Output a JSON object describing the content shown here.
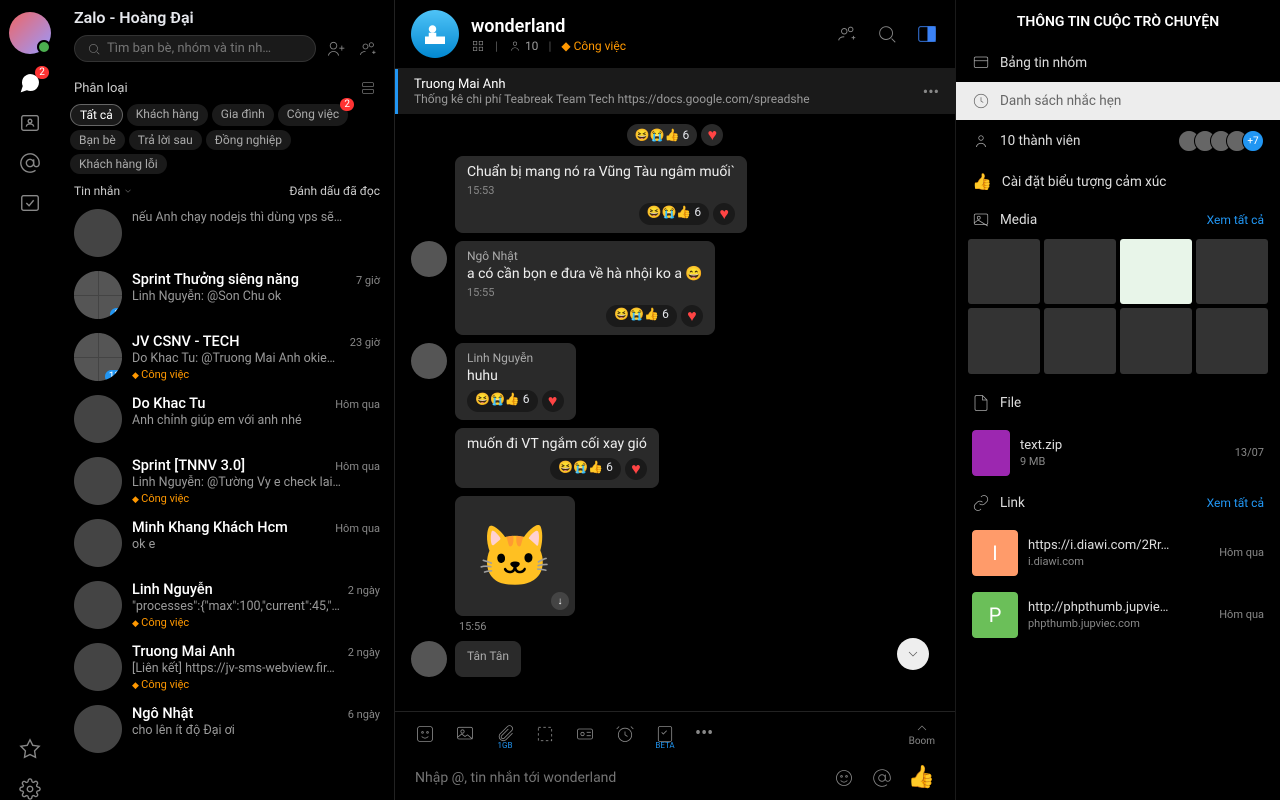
{
  "app_title": "Zalo - Hoàng Đại",
  "search_placeholder": "Tìm bạn bè, nhóm và tin nh…",
  "nav": {
    "chat_badge": "2"
  },
  "filter": {
    "label": "Phân loại",
    "chips": [
      "Tất cả",
      "Khách hàng",
      "Gia đình",
      "Công việc",
      "Bạn bè",
      "Trả lời sau",
      "Đồng nghiệp",
      "Khách hàng lỗi"
    ],
    "chip3_badge": "2"
  },
  "subheader": {
    "left": "Tin nhắn",
    "right": "Đánh dấu đã đọc"
  },
  "conversations": [
    {
      "name": "",
      "preview": "nếu Anh chạy nodejs thì dùng vps sẽ…",
      "time": "",
      "tag": "",
      "grp": false
    },
    {
      "name": "Sprint Thưởng siêng năng",
      "preview": "Linh Nguyễn: @Son Chu ok",
      "time": "7 giờ",
      "tag": "",
      "grp": true,
      "count": "9"
    },
    {
      "name": "JV CSNV - TECH",
      "preview": "Do Khac Tu: @Truong Mai Anh okie…",
      "time": "23 giờ",
      "tag": "Công việc",
      "grp": true,
      "count": "13"
    },
    {
      "name": "Do Khac Tu",
      "preview": "Anh chỉnh giúp em với anh nhé",
      "time": "Hôm qua",
      "tag": "",
      "grp": false
    },
    {
      "name": "Sprint [TNNV 3.0]",
      "preview": "Linh Nguyễn: @Tường Vy e check lai…",
      "time": "Hôm qua",
      "tag": "Công việc",
      "grp": false
    },
    {
      "name": "Minh Khang Khách Hcm",
      "preview": "ok e",
      "time": "Hôm qua",
      "tag": "",
      "grp": false
    },
    {
      "name": "Linh Nguyễn",
      "preview": "\"processes\":{\"max\":100,\"current\":45,\"…",
      "time": "2 ngày",
      "tag": "Công việc",
      "grp": false
    },
    {
      "name": "Truong Mai Anh",
      "preview": "[Liên kết] https://jv-sms-webview.fir…",
      "time": "2 ngày",
      "tag": "Công việc",
      "grp": false
    },
    {
      "name": "Ngô Nhật",
      "preview": "cho lên ít độ Đại ơi",
      "time": "6 ngày",
      "tag": "",
      "grp": false
    }
  ],
  "chat": {
    "title": "wonderland",
    "members": "10",
    "tag_label": "Công việc",
    "pinned": {
      "title": "Truong Mai Anh",
      "desc": "Thống kê chi phí Teabreak Team Tech https://docs.google.com/spreadshe"
    },
    "reac_top": "6",
    "messages": [
      {
        "sender": "",
        "text": "Chuẩn bị mang nó ra Vũng Tàu ngâm muối`",
        "time": "15:53",
        "reac": "6",
        "cont": true
      },
      {
        "sender": "Ngô Nhật",
        "text": "a có cần bọn e đưa về hà nhội ko a 😄",
        "time": "15:55",
        "reac": "6",
        "cont": false
      },
      {
        "sender": "Linh Nguyễn",
        "text": "huhu",
        "time": "",
        "reac": "6",
        "cont": false
      },
      {
        "sender": "",
        "text": "muốn đi VT ngắm cối xay gió",
        "time": "",
        "reac": "6",
        "cont": true
      },
      {
        "sender": "",
        "sticker": true,
        "time": "15:56",
        "cont": true
      },
      {
        "sender": "Tân Tân",
        "text": "",
        "cont": false
      }
    ],
    "input_placeholder": "Nhập @, tin nhắn tới wonderland",
    "tool_gb": "1GB",
    "tool_beta": "BETA",
    "boom": "Boom"
  },
  "info": {
    "title": "THÔNG TIN CUỘC TRÒ CHUYỆN",
    "board": "Bảng tin nhóm",
    "reminders": "Danh sách nhắc hẹn",
    "members": "10 thành viên",
    "members_plus": "+7",
    "emoji": "Cài đặt biểu tượng cảm xúc",
    "media": "Media",
    "view_all": "Xem tất cả",
    "file": "File",
    "file_item": {
      "name": "text.zip",
      "size": "9 MB",
      "date": "13/07"
    },
    "link": "Link",
    "links": [
      {
        "url": "https://i.diawi.com/2Rr…",
        "domain": "i.diawi.com",
        "date": "Hôm qua",
        "color": "#ff9b6a",
        "letter": "I"
      },
      {
        "url": "http://phpthumb.jupvie…",
        "domain": "phpthumb.jupviec.com",
        "date": "Hôm qua",
        "color": "#6bbf59",
        "letter": "P"
      }
    ]
  }
}
